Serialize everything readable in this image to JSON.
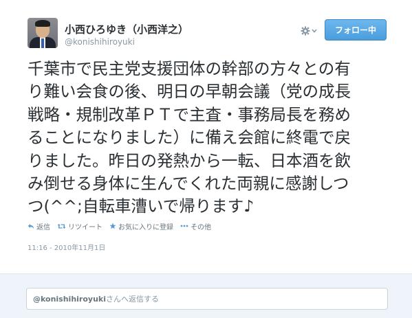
{
  "user": {
    "display_name": "小西ひろゆき（小西洋之）",
    "handle": "@konishihiroyuki"
  },
  "follow_button": {
    "label": "フォロー中"
  },
  "tweet": {
    "lines": [
      "千葉市で民主党支援団体の幹部の方々との有",
      "り難い会食の後、明日の早朝会議（党の成長",
      "戦略・規制改革ＰＴで主査・事務局長を務め",
      "ることになりました）に備え会館に終電で戻",
      "りました。昨日の発熱から一転、日本酒を飲",
      "み倒せる身体に生んでくれた両親に感謝しつ",
      "つ(^^;自転車漕いで帰ります♪"
    ],
    "timestamp": "11:16 - 2010年11月1日"
  },
  "actions": {
    "reply": "返信",
    "retweet": "リツイート",
    "favorite": "お気に入りに登録",
    "more": "その他"
  },
  "reply_box": {
    "mention": "@konishihiroyuki",
    "suffix": "さんへ返信する"
  },
  "icons": {
    "gear": "gear-icon",
    "reply": "reply-icon",
    "retweet": "retweet-icon",
    "favorite": "star-icon",
    "more": "more-dots-icon"
  },
  "colors": {
    "follow_button": "#55acee",
    "text": "#292f33",
    "muted": "#8899a6",
    "reply_area_bg": "#eef4f9"
  }
}
